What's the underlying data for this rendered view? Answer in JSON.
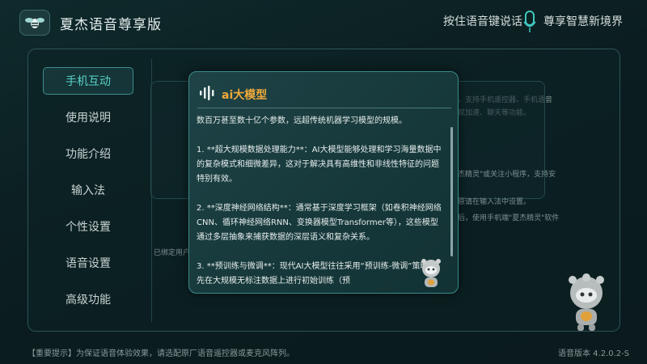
{
  "header": {
    "app_title": "夏杰语音尊享版",
    "voice_hint": "按住语音键说话",
    "slogan": "尊享智慧新境界"
  },
  "sidebar": {
    "items": [
      {
        "label": "手机互动",
        "active": true
      },
      {
        "label": "使用说明",
        "active": false
      },
      {
        "label": "功能介绍",
        "active": false
      },
      {
        "label": "输入法",
        "active": false
      },
      {
        "label": "个性设置",
        "active": false
      },
      {
        "label": "语音设置",
        "active": false
      },
      {
        "label": "高级功能",
        "active": false
      }
    ]
  },
  "background_content": {
    "line1": "，支持手机遥控器、手机语音",
    "line2": "就加速、聊天等功能。",
    "card_line1": "杰精灵\"或关注小程序，支持安",
    "card_line2": "原请在输入法中设置。",
    "card_line3": "后，使用手机端\"夏杰精灵\"软件",
    "bound_user": "已绑定用户："
  },
  "dialog": {
    "title": "ai大模型",
    "paragraphs": [
      "数百万甚至数十亿个参数，远超传统机器学习模型的规模。",
      "1. **超大规模数据处理能力**：AI大模型能够处理和学习海量数据中的复杂模式和细微差异，这对于解决具有高维性和非线性特征的问题特别有效。",
      "2. **深度神经网络结构**：通常基于深度学习框架（如卷积神经网络CNN、循环神经网络RNN、变换器模型Transformer等），这些模型通过多层抽象来捕获数据的深层语义和复杂关系。",
      "3. **预训练与微调**：现代AI大模型往往采用“预训练-微调”策略，先在大规模无标注数据上进行初始训练（预"
    ]
  },
  "footer": {
    "tip": "【重要提示】为保证语音体验效果，请选配原厂语音遥控器或麦克风阵列。",
    "version": "语音版本  4.2.0.2-S"
  },
  "colors": {
    "accent_teal": "#5ad1c7",
    "dialog_title_orange": "#f0a93b",
    "background": "#0b1d20"
  }
}
